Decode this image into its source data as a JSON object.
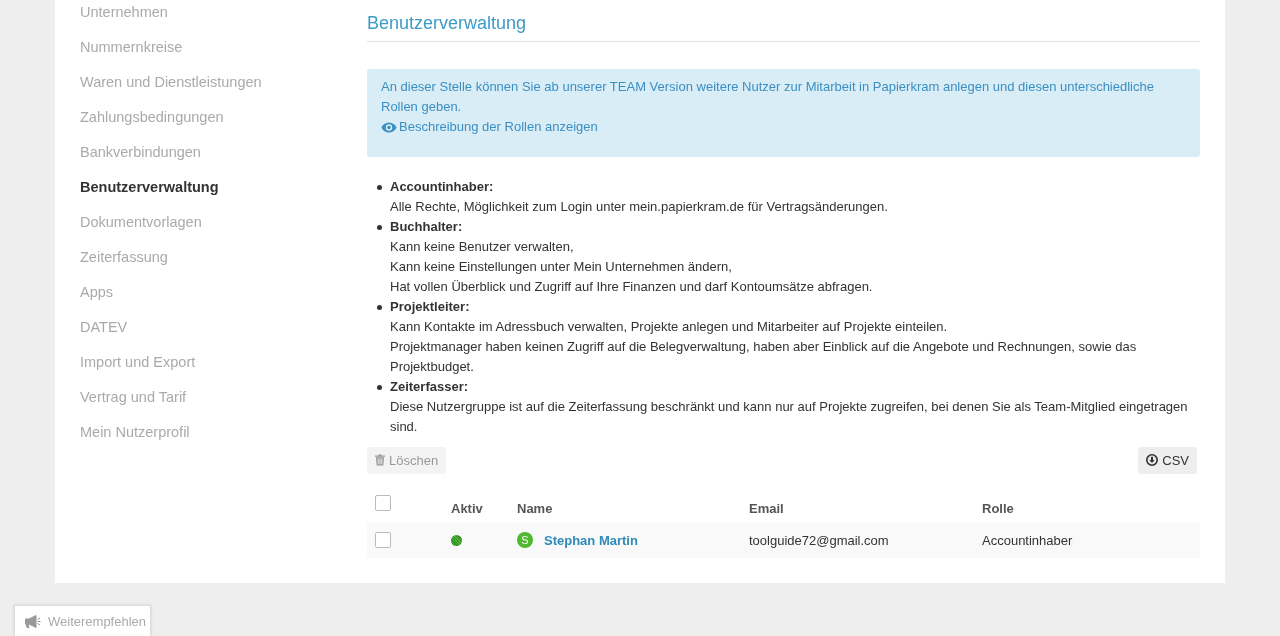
{
  "sidebar": {
    "items": [
      {
        "label": "Unternehmen",
        "selected": false
      },
      {
        "label": "Nummernkreise",
        "selected": false
      },
      {
        "label": "Waren und Dienstleistungen",
        "selected": false
      },
      {
        "label": "Zahlungsbedingungen",
        "selected": false
      },
      {
        "label": "Bankverbindungen",
        "selected": false
      },
      {
        "label": "Benutzerverwaltung",
        "selected": true
      },
      {
        "label": "Dokumentvorlagen",
        "selected": false
      },
      {
        "label": "Zeiterfassung",
        "selected": false
      },
      {
        "label": "Apps",
        "selected": false
      },
      {
        "label": "DATEV",
        "selected": false
      },
      {
        "label": "Import und Export",
        "selected": false
      },
      {
        "label": "Vertrag und Tarif",
        "selected": false
      },
      {
        "label": "Mein Nutzerprofil",
        "selected": false
      }
    ]
  },
  "main": {
    "title": "Benutzerverwaltung",
    "info_box": {
      "text": "An dieser Stelle können Sie ab unserer TEAM Version weitere Nutzer zur Mitarbeit in Papierkram anlegen und diesen unterschiedliche Rollen geben.",
      "link": "Beschreibung der Rollen anzeigen"
    },
    "roles": [
      {
        "name": "Accountinhaber:",
        "lines": [
          "Alle Rechte, Möglichkeit zum Login unter mein.papierkram.de für Vertragsänderungen."
        ]
      },
      {
        "name": "Buchhalter:",
        "lines": [
          "Kann keine Benutzer verwalten,",
          "Kann keine Einstellungen unter Mein Unternehmen ändern,",
          "Hat vollen Überblick und Zugriff auf Ihre Finanzen und darf Kontoumsätze abfragen."
        ]
      },
      {
        "name": "Projektleiter:",
        "lines": [
          "Kann Kontakte im Adressbuch verwalten, Projekte anlegen und Mitarbeiter auf Projekte einteilen.",
          "Projektmanager haben keinen Zugriff auf die Belegverwaltung, haben aber Einblick auf die Angebote und Rechnungen, sowie das Projektbudget."
        ]
      },
      {
        "name": "Zeiterfasser:",
        "lines": [
          "Diese Nutzergruppe ist auf die Zeiterfassung beschränkt und kann nur auf Projekte zugreifen, bei denen Sie als Team-Mitglied eingetragen sind."
        ]
      }
    ],
    "toolbar": {
      "delete_button": {
        "label": "Löschen",
        "disabled": true
      },
      "export_button": {
        "label": "CSV"
      }
    },
    "table": {
      "select_all": {
        "checked": false
      },
      "columns": [
        "Aktiv",
        "Name",
        "Email",
        "Rolle"
      ],
      "rows": [
        {
          "selected": false,
          "active": true,
          "avatar_initial": "S",
          "name": "Stephan Martin",
          "email": "toolguide72@gmail.com",
          "role": "Accountinhaber"
        }
      ]
    }
  },
  "recommend_button": {
    "label": "Weiterempfehlen"
  }
}
